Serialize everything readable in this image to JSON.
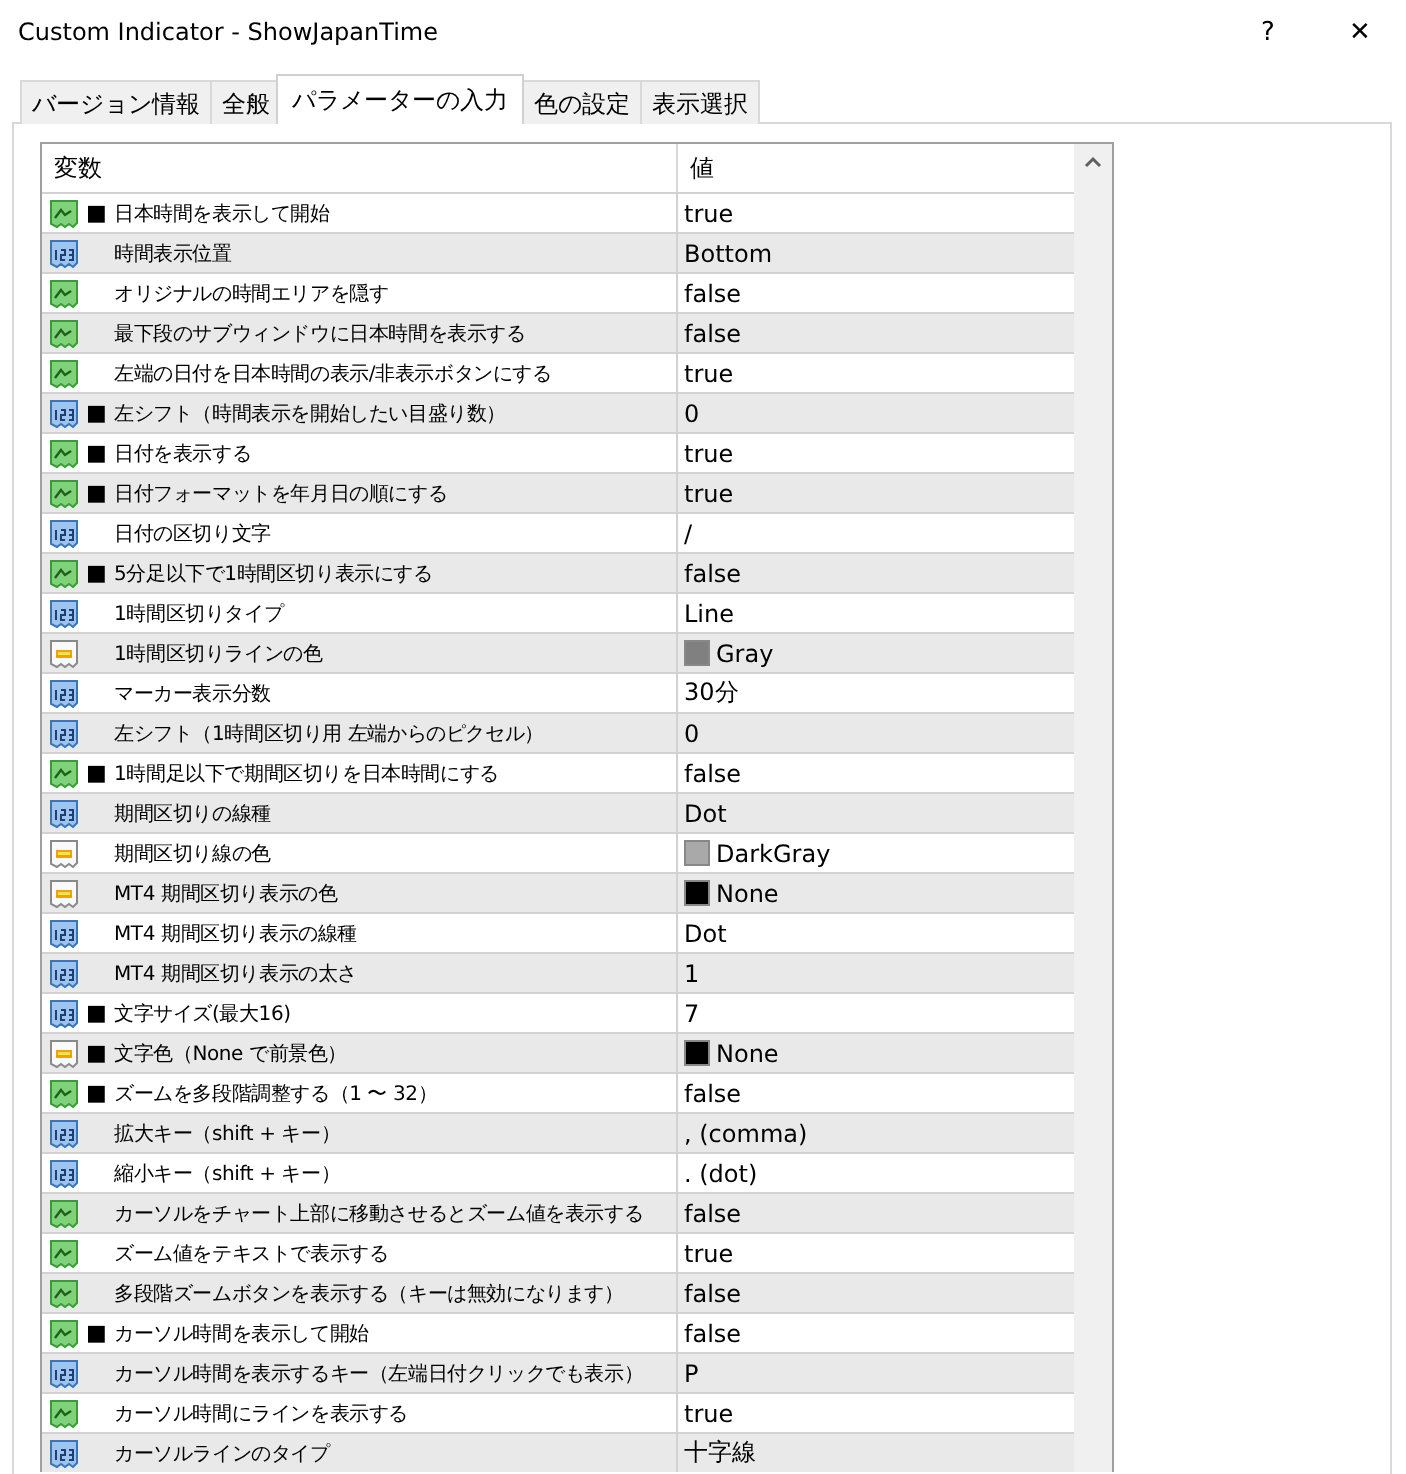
{
  "window": {
    "title": "Custom Indicator - ShowJapanTime",
    "help": "?",
    "close": "✕"
  },
  "tabs": [
    {
      "label": "バージョン情報",
      "selected": false
    },
    {
      "label": "全般",
      "selected": false
    },
    {
      "label": "パラメーターの入力",
      "selected": true
    },
    {
      "label": "色の設定",
      "selected": false
    },
    {
      "label": "表示選択",
      "selected": false
    }
  ],
  "table": {
    "columns": [
      "変数",
      "値"
    ],
    "rows": [
      {
        "kind": "bool",
        "bullet": "■",
        "name": "日本時間を表示して開始",
        "value": "true"
      },
      {
        "kind": "int",
        "name": "時間表示位置",
        "value": "Bottom"
      },
      {
        "kind": "bool",
        "name": "オリジナルの時間エリアを隠す",
        "value": "false"
      },
      {
        "kind": "bool",
        "name": "最下段のサブウィンドウに日本時間を表示する",
        "value": "false"
      },
      {
        "kind": "bool",
        "name": "左端の日付を日本時間の表示/非表示ボタンにする",
        "value": "true"
      },
      {
        "kind": "int",
        "bullet": "■",
        "name": "左シフト（時間表示を開始したい目盛り数）",
        "value": "0"
      },
      {
        "kind": "bool",
        "bullet": "■",
        "name": "日付を表示する",
        "value": "true"
      },
      {
        "kind": "bool",
        "bullet": "■",
        "name": "日付フォーマットを年月日の順にする",
        "value": "true"
      },
      {
        "kind": "int",
        "name": "日付の区切り文字",
        "value": "/"
      },
      {
        "kind": "bool",
        "bullet": "■",
        "name": "5分足以下で1時間区切り表示にする",
        "value": "false"
      },
      {
        "kind": "int",
        "name": "1時間区切りタイプ",
        "value": "Line"
      },
      {
        "kind": "color",
        "name": "1時間区切りラインの色",
        "value": "Gray",
        "color": "#808080"
      },
      {
        "kind": "int",
        "name": "マーカー表示分数",
        "value": "30分"
      },
      {
        "kind": "int",
        "name": "左シフト（1時間区切り用 左端からのピクセル）",
        "value": "0"
      },
      {
        "kind": "bool",
        "bullet": "■",
        "name": "1時間足以下で期間区切りを日本時間にする",
        "value": "false"
      },
      {
        "kind": "int",
        "name": "期間区切りの線種",
        "value": "Dot"
      },
      {
        "kind": "color",
        "name": "期間区切り線の色",
        "value": "DarkGray",
        "color": "#a9a9a9"
      },
      {
        "kind": "color",
        "name": "MT4 期間区切り表示の色",
        "value": "None",
        "color": "#000000"
      },
      {
        "kind": "int",
        "name": "MT4 期間区切り表示の線種",
        "value": "Dot"
      },
      {
        "kind": "int",
        "name": "MT4 期間区切り表示の太さ",
        "value": "1"
      },
      {
        "kind": "int",
        "bullet": "■",
        "name": "文字サイズ(最大16)",
        "value": "7"
      },
      {
        "kind": "color",
        "bullet": "■",
        "name": "文字色（None で前景色）",
        "value": "None",
        "color": "#000000"
      },
      {
        "kind": "bool",
        "bullet": "■",
        "name": "ズームを多段階調整する（1 〜 32）",
        "value": "false"
      },
      {
        "kind": "int",
        "name": "拡大キー（shift + キー）",
        "value": ", (comma)"
      },
      {
        "kind": "int",
        "name": "縮小キー（shift + キー）",
        "value": ". (dot)"
      },
      {
        "kind": "bool",
        "name": "カーソルをチャート上部に移動させるとズーム値を表示する",
        "value": "false"
      },
      {
        "kind": "bool",
        "name": "ズーム値をテキストで表示する",
        "value": "true"
      },
      {
        "kind": "bool",
        "name": "多段階ズームボタンを表示する（キーは無効になります）",
        "value": "false"
      },
      {
        "kind": "bool",
        "bullet": "■",
        "name": "カーソル時間を表示して開始",
        "value": "false"
      },
      {
        "kind": "int",
        "name": "カーソル時間を表示するキー（左端日付クリックでも表示）",
        "value": "P"
      },
      {
        "kind": "bool",
        "name": "カーソル時間にラインを表示する",
        "value": "true"
      },
      {
        "kind": "int",
        "name": "カーソルラインのタイプ",
        "value": "十字線"
      }
    ]
  }
}
